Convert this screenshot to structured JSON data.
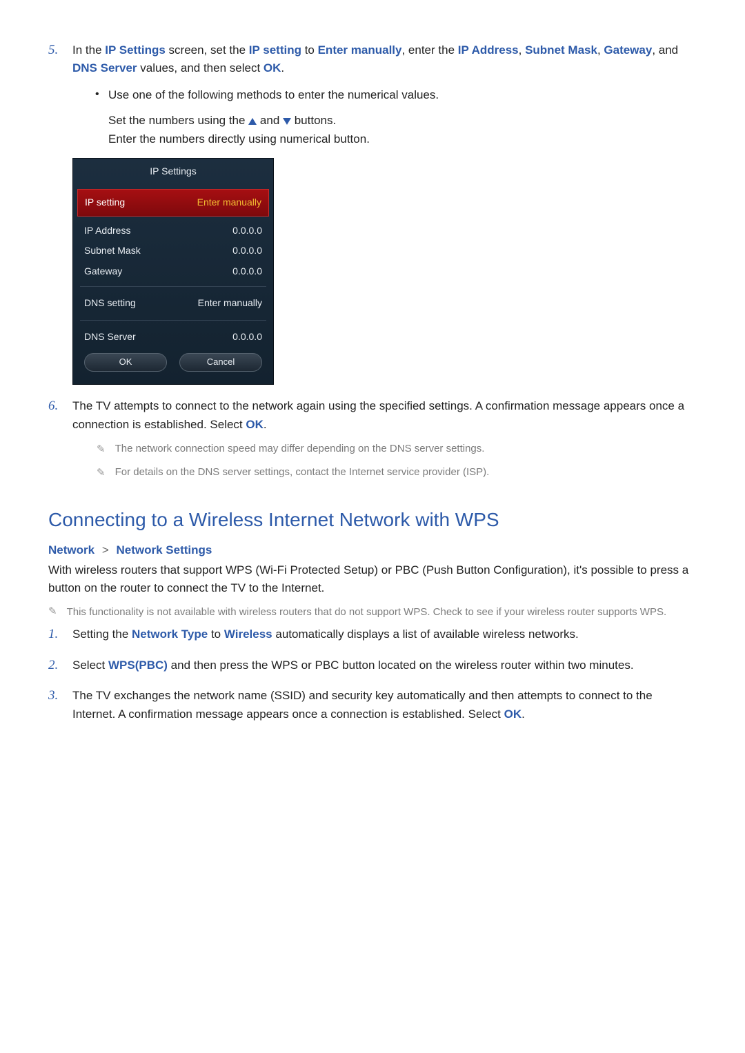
{
  "step5": {
    "num": "5.",
    "pre": "In the ",
    "kw_screen": "IP Settings",
    "mid1": " screen, set the ",
    "kw_setting": "IP setting",
    "mid2": " to ",
    "kw_enter": "Enter manually",
    "mid3": ", enter the ",
    "kw_ip": "IP Address",
    "comma1": ", ",
    "kw_subnet": "Subnet Mask",
    "comma2": ", ",
    "kw_gateway": "Gateway",
    "mid4": ", and ",
    "kw_dns": "DNS Server",
    "mid5": " values, and then select ",
    "kw_ok": "OK",
    "tail": ".",
    "bullet": "Use one of the following methods to enter the numerical values.",
    "line1_a": "Set the numbers using the ",
    "line1_b": " and ",
    "line1_c": " buttons.",
    "line2": "Enter the numbers directly using numerical button."
  },
  "panel": {
    "title": "IP Settings",
    "row1_label": "IP setting",
    "row1_value": "Enter manually",
    "row2_label": "IP Address",
    "row2_value": "0.0.0.0",
    "row3_label": "Subnet Mask",
    "row3_value": "0.0.0.0",
    "row4_label": "Gateway",
    "row4_value": "0.0.0.0",
    "row5_label": "DNS setting",
    "row5_value": "Enter manually",
    "row6_label": "DNS Server",
    "row6_value": "0.0.0.0",
    "ok": "OK",
    "cancel": "Cancel"
  },
  "step6": {
    "num": "6.",
    "text_a": "The TV attempts to connect to the network again using the specified settings. A confirmation message appears once a connection is established. Select ",
    "kw_ok": "OK",
    "tail": ".",
    "note1": "The network connection speed may differ depending on the DNS server settings.",
    "note2": "For details on the DNS server settings, contact the Internet service provider (ISP)."
  },
  "heading": "Connecting to a Wireless Internet Network with WPS",
  "breadcrumb": {
    "a": "Network",
    "sep": ">",
    "b": "Network Settings"
  },
  "wps_intro": "With wireless routers that support WPS (Wi-Fi Protected Setup) or PBC (Push Button Configuration), it's possible to press a button on the router to connect the TV to the Internet.",
  "wps_note": "This functionality is not available with wireless routers that do not support WPS. Check to see if your wireless router supports WPS.",
  "wps1": {
    "num": "1.",
    "a": "Setting the ",
    "kw_net": "Network Type",
    "b": " to ",
    "kw_wl": "Wireless",
    "c": " automatically displays a list of available wireless networks."
  },
  "wps2": {
    "num": "2.",
    "a": "Select ",
    "kw": "WPS(PBC)",
    "b": " and then press the WPS or PBC button located on the wireless router within two minutes."
  },
  "wps3": {
    "num": "3.",
    "a": "The TV exchanges the network name (SSID) and security key automatically and then attempts to connect to the Internet. A confirmation message appears once a connection is established. Select ",
    "kw_ok": "OK",
    "tail": "."
  },
  "icon": {
    "pencil": "✎"
  }
}
